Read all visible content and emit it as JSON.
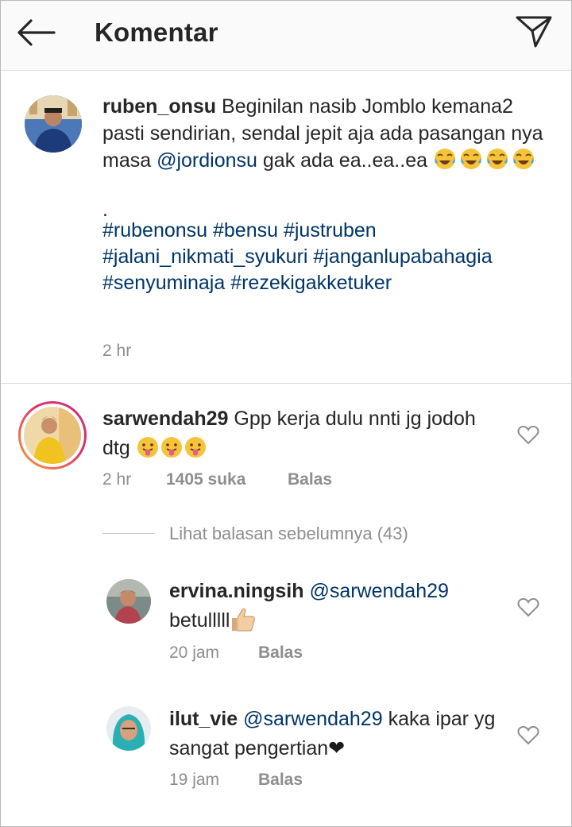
{
  "header": {
    "title": "Komentar",
    "back_icon": "arrow-left-icon",
    "send_icon": "paper-plane-icon"
  },
  "caption": {
    "username": "ruben_onsu",
    "text_1": "Beginilan nasib Jomblo kemana2 pasti sendirian, sendal jepit aja ada pasangan nya masa",
    "mention": "@jordionsu",
    "text_2": "gak ada ea..ea..ea",
    "emoji": "face-with-tears-of-joy",
    "dot": ".",
    "hashtags": "#rubenonsu #bensu #justruben #jalani_nikmati_syukuri #janganlupabahagia #senyuminaja #rezekigakketuker",
    "time": "2 hr"
  },
  "comments": [
    {
      "username": "sarwendah29",
      "text": "Gpp kerja dulu nnti jg jodoh dtg",
      "emoji": "face-with-tongue",
      "time": "2 hr",
      "likes": "1405 suka",
      "reply": "Balas"
    }
  ],
  "view_previous": "Lihat balasan sebelumnya (43)",
  "replies": [
    {
      "username": "ervina.ningsih",
      "mention": "@sarwendah29",
      "text": "betulllll",
      "emoji": "thumbs-up",
      "time": "20 jam",
      "reply": "Balas"
    },
    {
      "username": "ilut_vie",
      "mention": "@sarwendah29",
      "text": "kaka ipar yg sangat pengertian",
      "emoji": "black-heart",
      "heart_char": "❤",
      "time": "19 jam",
      "reply": "Balas"
    }
  ],
  "colors": {
    "link": "#003569",
    "muted": "#8e8e8e",
    "story_ring_start": "#f9a13a",
    "story_ring_end": "#c13584"
  }
}
